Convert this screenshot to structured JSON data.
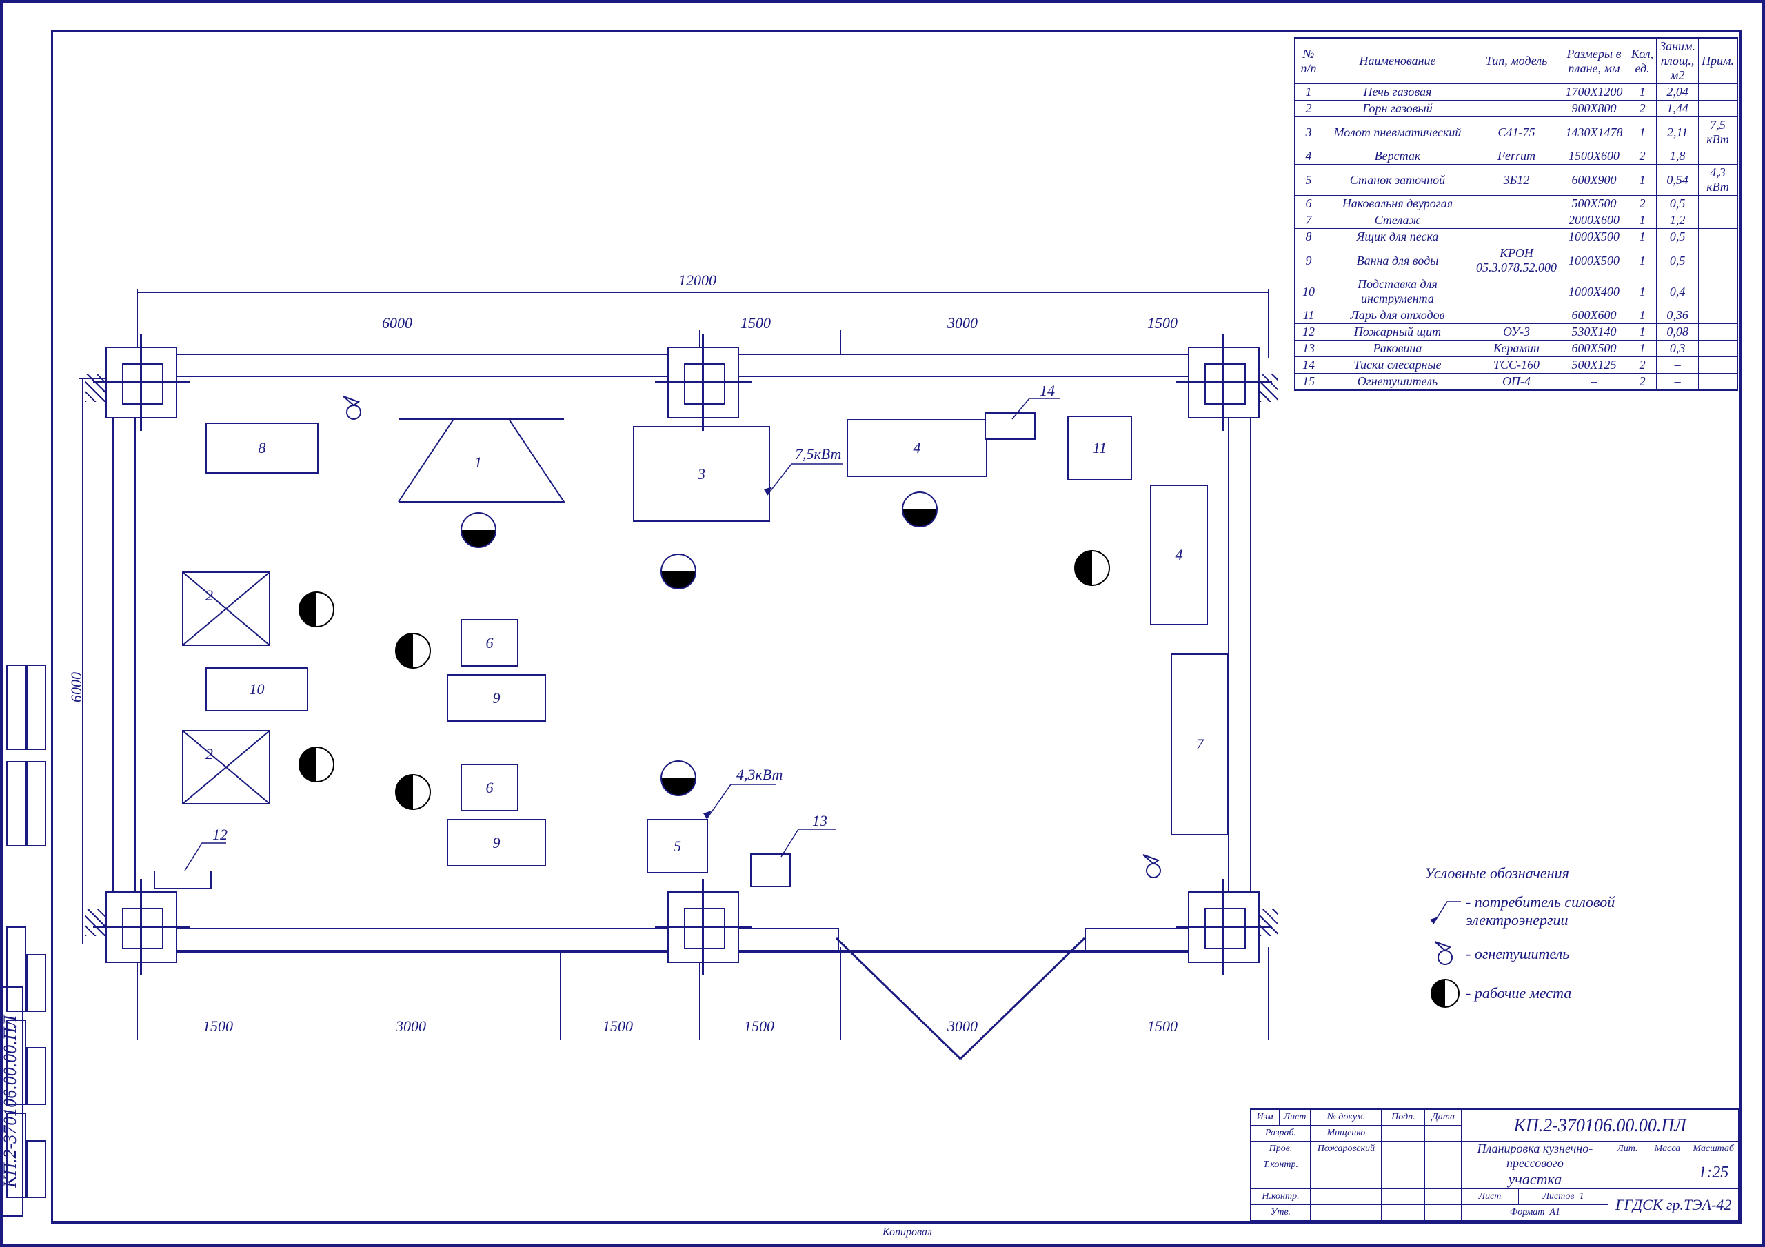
{
  "drawing_code": "КП.2-370106.00.00.ПЛ",
  "dims": {
    "overall_w": "12000",
    "overall_h": "6000",
    "top": [
      "6000",
      "1500",
      "3000",
      "1500"
    ],
    "bot": [
      "1500",
      "3000",
      "1500",
      "1500",
      "3000",
      "1500"
    ]
  },
  "equipment_labels": {
    "e1": "1",
    "e2a": "2",
    "e2b": "2",
    "e3": "3",
    "e4a": "4",
    "e4b": "4",
    "e5": "5",
    "e6a": "6",
    "e6b": "6",
    "e7": "7",
    "e8": "8",
    "e9a": "9",
    "e9b": "9",
    "e10": "10",
    "e11": "11",
    "e12": "12",
    "e13": "13",
    "e14": "14"
  },
  "power": {
    "p3": "7,5кВт",
    "p5": "4,3кВт"
  },
  "legend": {
    "title": "Условные обозначения",
    "l1": "- потребитель силовой электроэнергии",
    "l2": "- огнетушитель",
    "l3": "- рабочие места"
  },
  "spec": {
    "headers": [
      "№ п/п",
      "Наименование",
      "Тип, модель",
      "Размеры в плане, мм",
      "Кол, ед.",
      "Заним. площ., м2",
      "Прим."
    ],
    "rows": [
      [
        "1",
        "Печь газовая",
        "",
        "1700X1200",
        "1",
        "2,04",
        ""
      ],
      [
        "2",
        "Горн газовый",
        "",
        "900X800",
        "2",
        "1,44",
        ""
      ],
      [
        "3",
        "Молот пневматический",
        "С41-75",
        "1430X1478",
        "1",
        "2,11",
        "7,5 кВт"
      ],
      [
        "4",
        "Верстак",
        "Ferrum",
        "1500X600",
        "2",
        "1,8",
        ""
      ],
      [
        "5",
        "Станок заточной",
        "3Б12",
        "600X900",
        "1",
        "0,54",
        "4,3 кВт"
      ],
      [
        "6",
        "Наковальня двурогая",
        "",
        "500X500",
        "2",
        "0,5",
        ""
      ],
      [
        "7",
        "Стелаж",
        "",
        "2000X600",
        "1",
        "1,2",
        ""
      ],
      [
        "8",
        "Ящик для песка",
        "",
        "1000X500",
        "1",
        "0,5",
        ""
      ],
      [
        "9",
        "Ванна для воды",
        "КРОН 05.3.078.52.000",
        "1000X500",
        "1",
        "0,5",
        ""
      ],
      [
        "10",
        "Подставка для инструмента",
        "",
        "1000X400",
        "1",
        "0,4",
        ""
      ],
      [
        "11",
        "Ларь для отходов",
        "",
        "600X600",
        "1",
        "0,36",
        ""
      ],
      [
        "12",
        "Пожарный щит",
        "ОУ-3",
        "530X140",
        "1",
        "0,08",
        ""
      ],
      [
        "13",
        "Раковина",
        "Керамин",
        "600X500",
        "1",
        "0,3",
        ""
      ],
      [
        "14",
        "Тиски слесарные",
        "ТСС-160",
        "500X125",
        "2",
        "–",
        ""
      ],
      [
        "15",
        "Огнетушитель",
        "ОП-4",
        "–",
        "2",
        "–",
        ""
      ]
    ]
  },
  "title_block": {
    "code": "КП.2-370106.00.00.ПЛ",
    "name1": "Планировка кузнечно-прессового",
    "name2": "участка",
    "scale": "1:25",
    "org": "ГГДСК гр.ТЭА-42",
    "roles": [
      "Изм",
      "Лист",
      "№ докум.",
      "Подп.",
      "Дата"
    ],
    "r1": [
      "Разраб.",
      "Мищенко"
    ],
    "r2": [
      "Пров.",
      "Пожаровский"
    ],
    "r3": "Т.контр.",
    "r4": "Н.контр.",
    "r5": "Утв.",
    "lit": "Лит.",
    "massa": "Масса",
    "mas": "Масштаб",
    "list": "Лист",
    "listov": "Листов",
    "listov_v": "1",
    "format": "Формат",
    "format_v": "А1",
    "kopiroval": "Копировал"
  }
}
